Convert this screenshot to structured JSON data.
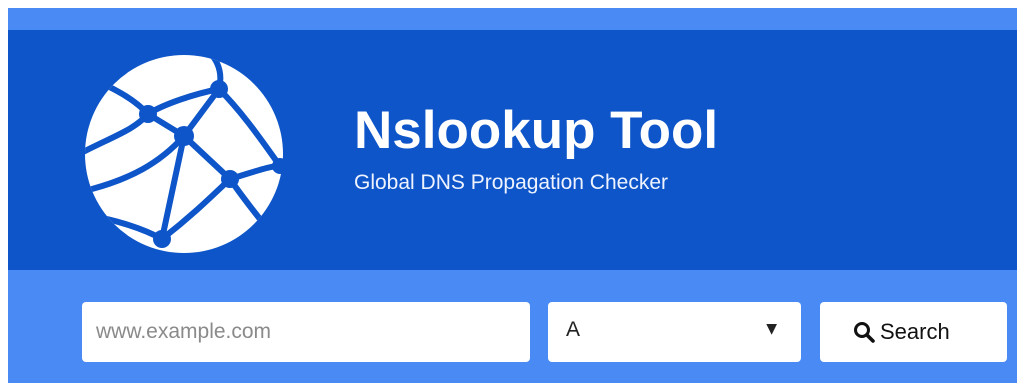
{
  "header": {
    "title": "Nslookup Tool",
    "subtitle": "Global DNS Propagation Checker",
    "logo_icon": "network-globe-icon"
  },
  "search": {
    "domain_placeholder": "www.example.com",
    "domain_value": "",
    "record_type": "A",
    "select_arrow": "▼",
    "button_label": "Search",
    "button_icon": "search-icon"
  },
  "colors": {
    "outer_background": "#4a8af4",
    "header_background": "#0d55c8",
    "text_on_header": "#ffffff",
    "control_background": "#ffffff"
  }
}
